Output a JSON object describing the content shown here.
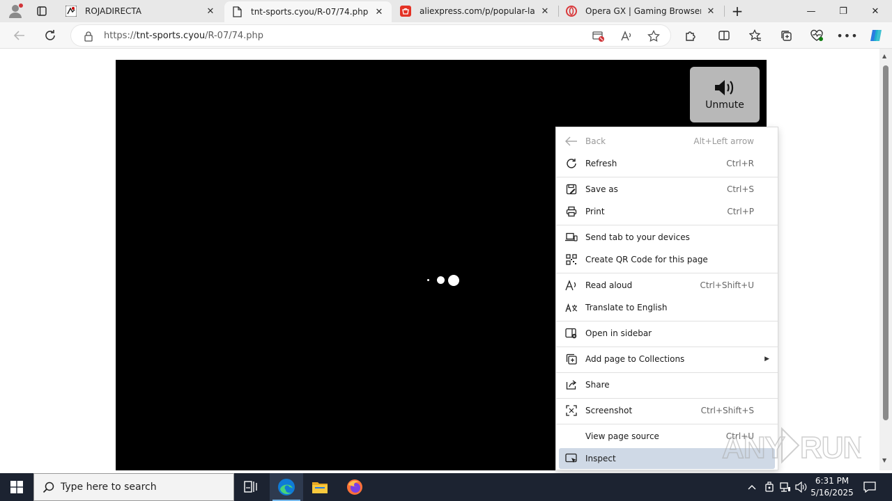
{
  "tabs": [
    {
      "title": "ROJADIRECTA",
      "active": false
    },
    {
      "title": "tnt-sports.cyou/R-07/74.php",
      "active": true
    },
    {
      "title": "aliexpress.com/p/popular-landin",
      "active": false
    },
    {
      "title": "Opera GX | Gaming Browser | Op",
      "active": false
    }
  ],
  "tab_close_glyph": "✕",
  "new_tab_glyph": "+",
  "window": {
    "minimize": "—",
    "restore": "❐",
    "close": "✕"
  },
  "address": {
    "scheme": "https://",
    "host": "tnt-sports.cyou",
    "path": "/R-07/74.php"
  },
  "player": {
    "unmute_label": "Unmute"
  },
  "context_menu": {
    "items": [
      {
        "label": "Back",
        "shortcut": "Alt+Left arrow",
        "icon": "back-arrow-icon",
        "disabled": true
      },
      {
        "label": "Refresh",
        "shortcut": "Ctrl+R",
        "icon": "refresh-icon"
      },
      {
        "label": "Save as",
        "shortcut": "Ctrl+S",
        "icon": "save-icon"
      },
      {
        "label": "Print",
        "shortcut": "Ctrl+P",
        "icon": "printer-icon"
      },
      {
        "label": "Send tab to your devices",
        "shortcut": "",
        "icon": "devices-icon"
      },
      {
        "label": "Create QR Code for this page",
        "shortcut": "",
        "icon": "qr-code-icon"
      },
      {
        "label": "Read aloud",
        "shortcut": "Ctrl+Shift+U",
        "icon": "read-aloud-icon"
      },
      {
        "label": "Translate to English",
        "shortcut": "",
        "icon": "translate-icon"
      },
      {
        "label": "Open in sidebar",
        "shortcut": "",
        "icon": "sidebar-icon"
      },
      {
        "label": "Add page to Collections",
        "shortcut": "",
        "icon": "collections-icon",
        "submenu": true
      },
      {
        "label": "Share",
        "shortcut": "",
        "icon": "share-icon"
      },
      {
        "label": "Screenshot",
        "shortcut": "Ctrl+Shift+S",
        "icon": "screenshot-icon"
      },
      {
        "label": "View page source",
        "shortcut": "Ctrl+U",
        "icon": ""
      },
      {
        "label": "Inspect",
        "shortcut": "",
        "icon": "inspect-icon",
        "highlighted": true
      }
    ],
    "submenu_arrow": "▶"
  },
  "taskbar": {
    "search_placeholder": "Type here to search",
    "clock_time": "6:31 PM",
    "clock_date": "5/16/2025"
  },
  "watermark": "ANY RUN",
  "colors": {
    "accent": "#0078d4",
    "menu_highlight": "#cfd9e6",
    "taskbar": "#1c2331"
  }
}
